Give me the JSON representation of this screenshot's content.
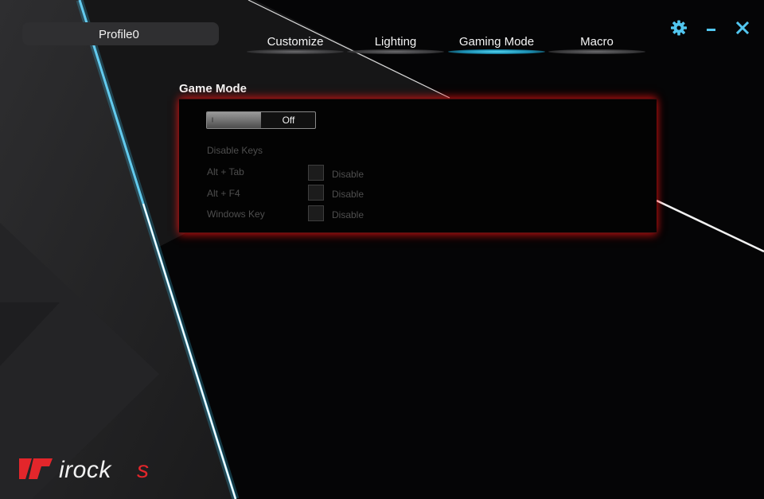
{
  "profile": {
    "name": "Profile0"
  },
  "tabs": [
    {
      "label": "Customize",
      "active": false
    },
    {
      "label": "Lighting",
      "active": false
    },
    {
      "label": "Gaming Mode",
      "active": true
    },
    {
      "label": "Macro",
      "active": false
    }
  ],
  "window_controls": {
    "settings_icon": "gear-icon",
    "minimize_icon": "minimize-icon",
    "close_icon": "close-icon"
  },
  "game_mode": {
    "title": "Game Mode",
    "toggle_state": "Off",
    "disable_keys_label": "Disable Keys",
    "keys": [
      {
        "key": "Alt + Tab",
        "option": "Disable",
        "checked": false
      },
      {
        "key": "Alt + F4",
        "option": "Disable",
        "checked": false
      },
      {
        "key": "Windows Key",
        "option": "Disable",
        "checked": false
      }
    ]
  },
  "brand": {
    "logo_text": "irocks",
    "accent": "#e3262b"
  },
  "colors": {
    "accent_blue": "#3fc7f0",
    "glow_red": "#ff1e1e"
  }
}
